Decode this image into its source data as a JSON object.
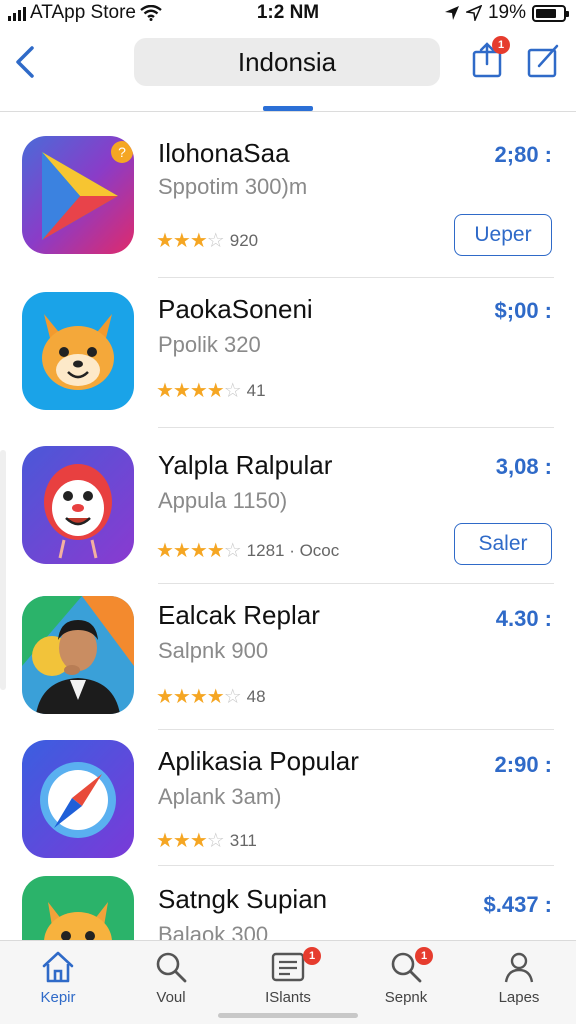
{
  "status_bar": {
    "carrier": "ATApp Store",
    "time": "1:2 NM",
    "battery": "19%"
  },
  "nav": {
    "title": "Indonsia",
    "share_badge": "1"
  },
  "apps": [
    {
      "name": "IlohonaSaa",
      "subtitle": "Sppotim 300)m",
      "rating": 3.5,
      "rating_text": "920",
      "price": "2;80 :",
      "action": "Ueper"
    },
    {
      "name": "PaokaSoneni",
      "subtitle": "Ppolik 320",
      "rating": 4.0,
      "rating_text": "41",
      "price": "$;00 :",
      "action": ""
    },
    {
      "name": "Yalpla Ralpular",
      "subtitle": "Appula 1150)",
      "rating": 4.0,
      "rating_text": "1281 · Ococ",
      "price": "3,08 :",
      "action": "Saler"
    },
    {
      "name": "Ealcak Replar",
      "subtitle": "Salpnk 900",
      "rating": 4.0,
      "rating_text": "48",
      "price": "4.30 :",
      "action": ""
    },
    {
      "name": "Aplikasia Popular",
      "subtitle": "Aplank 3am)",
      "rating": 3.5,
      "rating_text": "311",
      "price": "2:90 :",
      "action": ""
    },
    {
      "name": "Satngk Supian",
      "subtitle": "Balaok 300",
      "rating": 0,
      "rating_text": "",
      "price": "$.437 :",
      "action": ""
    }
  ],
  "tabbar": {
    "items": [
      {
        "label": "Kepir",
        "icon": "home-icon",
        "badge": ""
      },
      {
        "label": "Voul",
        "icon": "search-icon",
        "badge": ""
      },
      {
        "label": "ISlants",
        "icon": "list-icon",
        "badge": "1"
      },
      {
        "label": "Sepnk",
        "icon": "search-icon",
        "badge": "1"
      },
      {
        "label": "Lapes",
        "icon": "person-icon",
        "badge": ""
      }
    ]
  },
  "colors": {
    "accent": "#2f6ac8",
    "star": "#f5a623",
    "badge": "#e63c2e"
  }
}
